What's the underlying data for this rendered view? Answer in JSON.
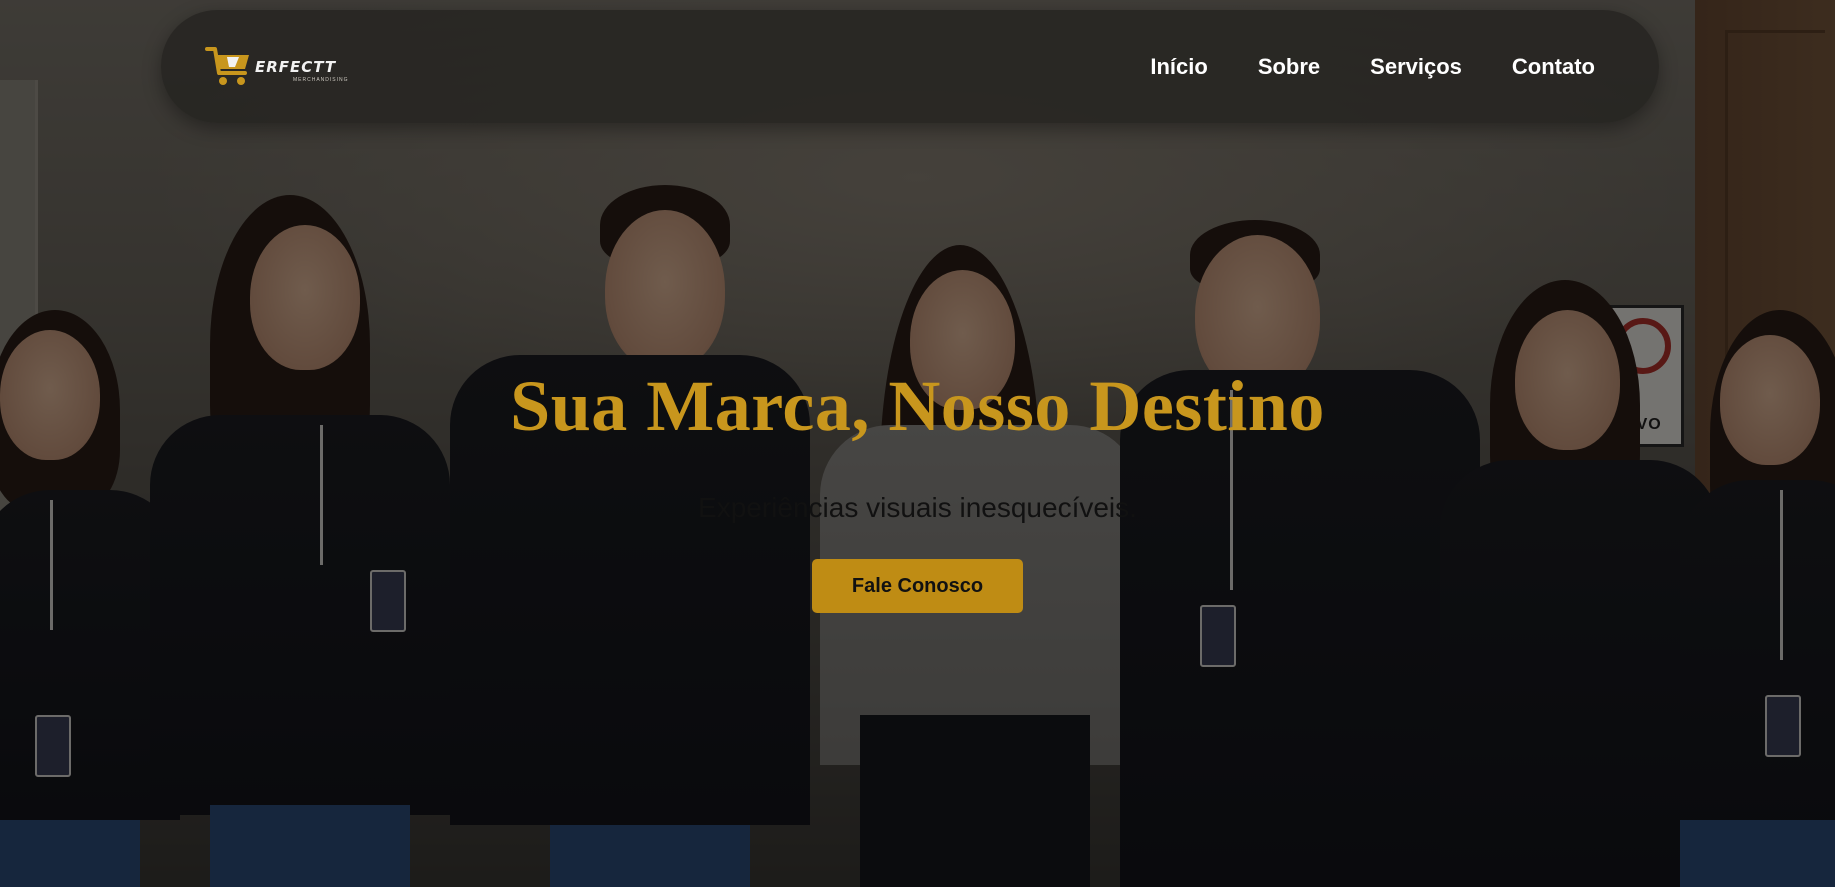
{
  "brand": {
    "logo_word": "ERFECTT",
    "logo_sub": "MERCHANDISING",
    "accent_color": "#c8961d",
    "logo_icon": "shopping-cart-icon"
  },
  "nav": {
    "items": [
      {
        "label": "Início"
      },
      {
        "label": "Sobre"
      },
      {
        "label": "Serviços"
      },
      {
        "label": "Contato"
      }
    ]
  },
  "hero": {
    "title": "Sua Marca, Nosso Destino",
    "subtitle": "Experiências visuais inesquecíveis.",
    "cta_label": "Fale Conosco",
    "cta_color": "#bf8c14",
    "sign_text": "ATIVO"
  }
}
